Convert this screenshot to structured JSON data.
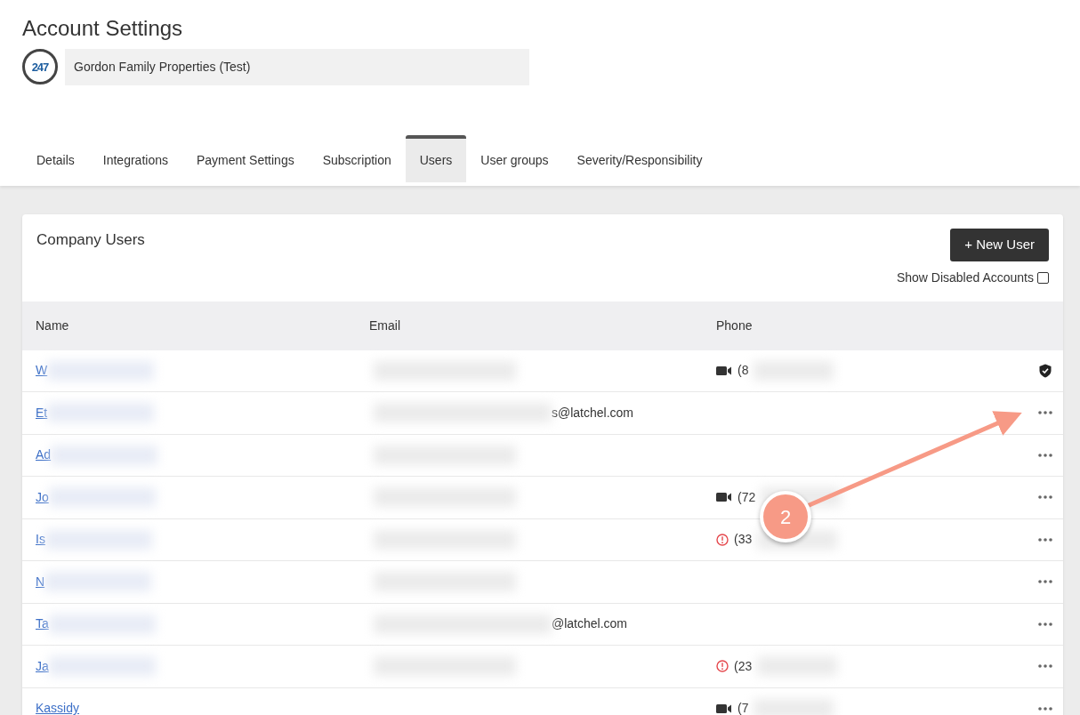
{
  "page": {
    "title": "Account Settings"
  },
  "account": {
    "logo": "247",
    "name": "Gordon Family Properties (Test)"
  },
  "tabs": [
    {
      "label": "Details",
      "selected": false
    },
    {
      "label": "Integrations",
      "selected": false
    },
    {
      "label": "Payment Settings",
      "selected": false
    },
    {
      "label": "Subscription",
      "selected": false
    },
    {
      "label": "Users",
      "selected": true
    },
    {
      "label": "User groups",
      "selected": false
    },
    {
      "label": "Severity/Responsibility",
      "selected": false
    }
  ],
  "card": {
    "title": "Company Users",
    "new_button": "+ New User",
    "show_disabled": {
      "label": "Show Disabled Accounts",
      "checked": false
    }
  },
  "table": {
    "columns": [
      "Name",
      "Email",
      "Phone"
    ],
    "rows": [
      {
        "name": "W",
        "redacted": true,
        "email": "",
        "phone": {
          "kind": "video",
          "text": "(8"
        },
        "action": {
          "kind": "shield"
        }
      },
      {
        "name": "Et",
        "redacted": true,
        "email": "s@latchel.com",
        "action": {
          "kind": "more"
        }
      },
      {
        "name": "Ad",
        "redacted": true,
        "email": "",
        "action": {
          "kind": "more"
        }
      },
      {
        "name": "Jo",
        "redacted": true,
        "email": "",
        "phone": {
          "kind": "video",
          "text": "(72"
        },
        "action": {
          "kind": "more"
        }
      },
      {
        "name": "Is",
        "redacted": true,
        "email": "",
        "phone": {
          "kind": "alert",
          "text": "(33"
        },
        "action": {
          "kind": "more"
        }
      },
      {
        "name": "N",
        "redacted": true,
        "email": "",
        "action": {
          "kind": "more"
        }
      },
      {
        "name": "Ta",
        "redacted": true,
        "email": "@latchel.com",
        "action": {
          "kind": "more"
        }
      },
      {
        "name": "Ja",
        "redacted": true,
        "email": "",
        "phone": {
          "kind": "alert",
          "text": "(23"
        },
        "action": {
          "kind": "more"
        }
      },
      {
        "name": "Kassidy",
        "redacted": false,
        "email": "",
        "phone": {
          "kind": "video",
          "text": "(7"
        },
        "action": {
          "kind": "more"
        }
      }
    ]
  },
  "annotation": {
    "number": "2"
  }
}
